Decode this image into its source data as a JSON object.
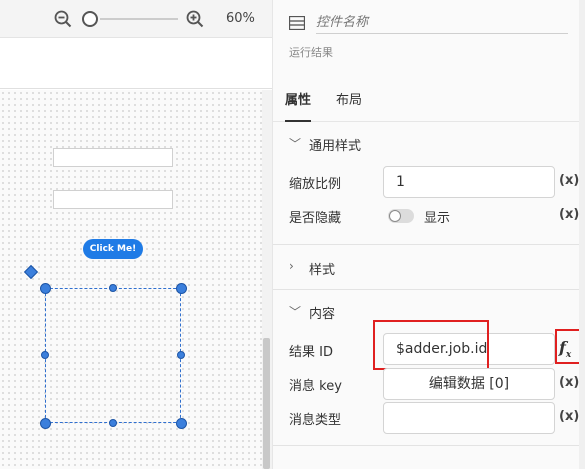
{
  "toolbar": {
    "zoom_level": "60%",
    "icons": {
      "zoom_out": "zoom-out-icon",
      "zoom_in": "zoom-in-icon"
    }
  },
  "canvas": {
    "button_label": "Click Me!"
  },
  "panel": {
    "name_placeholder": "控件名称",
    "subtitle": "运行结果",
    "tabs": [
      {
        "label": "属性",
        "active": true
      },
      {
        "label": "布局",
        "active": false
      }
    ],
    "sections": {
      "general": {
        "title": "通用样式",
        "scale": {
          "label": "缩放比例",
          "value": "1",
          "expr": "(x)"
        },
        "hidden": {
          "label": "是否隐藏",
          "toggle_text": "显示",
          "expr": "(x)"
        }
      },
      "style": {
        "title": "样式"
      },
      "content": {
        "title": "内容",
        "result_id": {
          "label": "结果 ID",
          "value": "$adder.job.id"
        },
        "message_key": {
          "label": "消息 key",
          "button": "编辑数据 [0]",
          "expr": "(x)"
        },
        "message_type": {
          "label": "消息类型",
          "value": "",
          "expr": "(x)"
        }
      }
    }
  },
  "colors": {
    "accent": "#1f7be6",
    "highlight": "#e02020"
  }
}
